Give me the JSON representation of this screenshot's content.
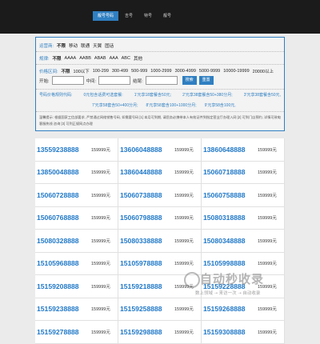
{
  "nav": {
    "tabs": [
      "靓号号码",
      "吉号",
      "特号",
      "靓号"
    ],
    "active": 0
  },
  "filter": {
    "operator": {
      "label": "运营商:",
      "options": [
        "不限",
        "移动",
        "联通",
        "天翼",
        "固话"
      ]
    },
    "rule": {
      "label": "规律:",
      "options": [
        "不限",
        "AAAA",
        "AABB",
        "ABAB",
        "AAA",
        "ABC",
        "其他"
      ]
    },
    "price": {
      "label": "价格区间:",
      "options": [
        "不限",
        "100以下",
        "100-299",
        "300-499",
        "500-999",
        "1000-2999",
        "3000-4999",
        "5000-9999",
        "10000-19999",
        "20000以上"
      ]
    },
    "search": {
      "begin_label": "开始:",
      "middle_label": "中间:",
      "end_label": "结尾:",
      "search_button": "搜索",
      "reset_button": "重置"
    },
    "pricing": {
      "label": "号码价格规则代码:",
      "items": [
        "0元包含话费可选套餐:",
        "1'元享18套餐含50元;",
        "2'元享38套餐含50+380分月;",
        "3'元享38套餐含50元,"
      ],
      "items2": [
        "7'元享58套含50+400分月;",
        "8'元享58套含100+1000分月;",
        "9'元享58含100元,"
      ]
    },
    "note": "温馨提示: 根据国家工信部要求, 严禁通过网络销售号码, 如需要号码 [1] 本月可到期, 请您务必携带本人有效证件到指定营业厅办理入网 [2] 可到门店预约, 详情可致电 客服热线 咨询 [3] 可到正规网点办理"
  },
  "numbers": [
    [
      "13559238888",
      "159999元",
      "13606048888",
      "159999元",
      "13860648888",
      "159999元"
    ],
    [
      "13850048888",
      "159999元",
      "13860448888",
      "159999元",
      "15060718888",
      "159999元"
    ],
    [
      "15060728888",
      "159999元",
      "15060738888",
      "159999元",
      "15060758888",
      "159999元"
    ],
    [
      "15060768888",
      "159999元",
      "15060798888",
      "159999元",
      "15080318888",
      "159999元"
    ],
    [
      "15080328888",
      "159999元",
      "15080338888",
      "159999元",
      "15080348888",
      "159999元"
    ],
    [
      "15105968888",
      "159999元",
      "15105978888",
      "159999元",
      "15105998888",
      "159999元"
    ],
    [
      "15159208888",
      "159999元",
      "15159218888",
      "159999元",
      "15159228888",
      "159999元"
    ],
    [
      "15159238888",
      "159999元",
      "15159258888",
      "159999元",
      "15159268888",
      "159999元"
    ],
    [
      "15159278888",
      "159999元",
      "15159298888",
      "159999元",
      "15159308888",
      "159999元"
    ]
  ],
  "watermark": {
    "title": "自动秒收录",
    "subtitle": "数上领域 ➝ 来访一次 ➝ 自动收录"
  }
}
